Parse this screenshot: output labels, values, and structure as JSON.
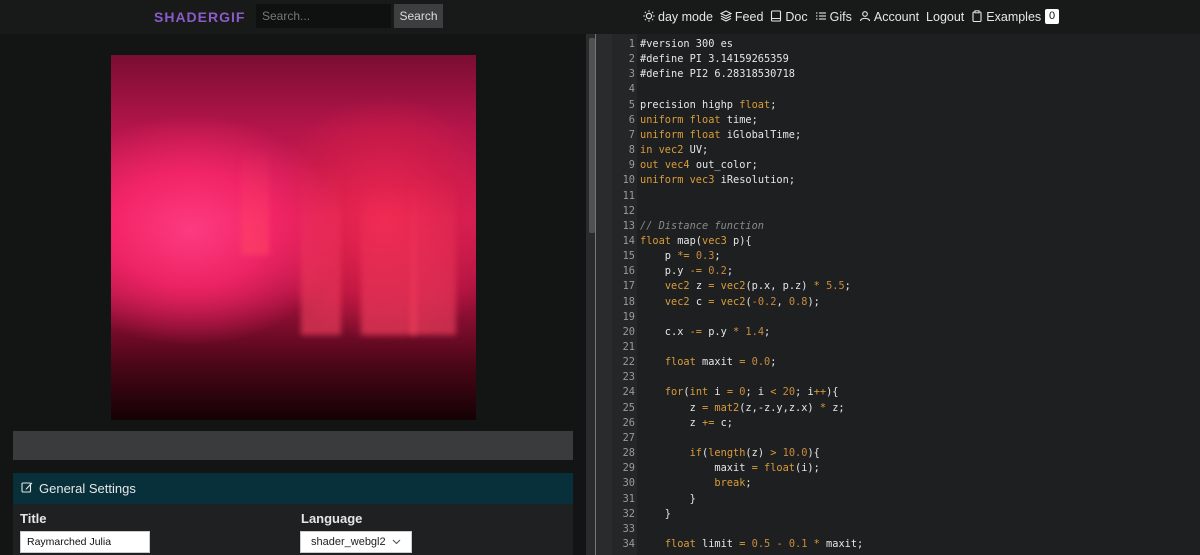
{
  "header": {
    "logo": "SHADERGIF",
    "search_placeholder": "Search...",
    "search_button": "Search",
    "nav": [
      {
        "label": "day mode",
        "icon": "sun-icon"
      },
      {
        "label": "Feed",
        "icon": "layers-icon"
      },
      {
        "label": "Doc",
        "icon": "book-icon"
      },
      {
        "label": "Gifs",
        "icon": "list-icon"
      },
      {
        "label": "Account",
        "icon": "user-icon"
      },
      {
        "label": "Logout",
        "icon": ""
      },
      {
        "label": "Examples",
        "icon": "clipboard-icon"
      }
    ],
    "badge": "0"
  },
  "settings": {
    "heading": "General Settings",
    "title_label": "Title",
    "title_value": "Raymarched Julia",
    "language_label": "Language",
    "language_value": "shader_webgl2"
  },
  "editor": {
    "lines": [
      [
        [
          "#version 300 es",
          ""
        ]
      ],
      [
        [
          "#define PI 3.14159265359",
          ""
        ]
      ],
      [
        [
          "#define PI2 6.28318530718",
          ""
        ]
      ],
      [],
      [
        [
          "precision highp ",
          ""
        ],
        [
          "float",
          "kw"
        ],
        [
          ";",
          ""
        ]
      ],
      [
        [
          "uniform",
          "kw"
        ],
        [
          " ",
          ""
        ],
        [
          "float",
          "kw"
        ],
        [
          " time;",
          ""
        ]
      ],
      [
        [
          "uniform",
          "kw"
        ],
        [
          " ",
          ""
        ],
        [
          "float",
          "kw"
        ],
        [
          " iGlobalTime;",
          ""
        ]
      ],
      [
        [
          "in",
          "kw"
        ],
        [
          " ",
          ""
        ],
        [
          "vec2",
          "kw"
        ],
        [
          " UV;",
          ""
        ]
      ],
      [
        [
          "out",
          "kw"
        ],
        [
          " ",
          ""
        ],
        [
          "vec4",
          "kw"
        ],
        [
          " out_color;",
          ""
        ]
      ],
      [
        [
          "uniform",
          "kw"
        ],
        [
          " ",
          ""
        ],
        [
          "vec3",
          "kw"
        ],
        [
          " iResolution;",
          ""
        ]
      ],
      [],
      [],
      [
        [
          "// Distance function",
          "cm"
        ]
      ],
      [
        [
          "float",
          "kw"
        ],
        [
          " map(",
          ""
        ],
        [
          "vec3",
          "kw"
        ],
        [
          " p){",
          ""
        ]
      ],
      [
        [
          "    p ",
          ""
        ],
        [
          "*=",
          "kw"
        ],
        [
          " ",
          ""
        ],
        [
          "0.3",
          "num"
        ],
        [
          ";",
          ""
        ]
      ],
      [
        [
          "    p.y ",
          ""
        ],
        [
          "-=",
          "kw"
        ],
        [
          " ",
          ""
        ],
        [
          "0.2",
          "num"
        ],
        [
          ";",
          ""
        ]
      ],
      [
        [
          "    ",
          ""
        ],
        [
          "vec2",
          "kw"
        ],
        [
          " z ",
          ""
        ],
        [
          "=",
          "kw"
        ],
        [
          " ",
          ""
        ],
        [
          "vec2",
          "kw"
        ],
        [
          "(p.x, p.z) ",
          ""
        ],
        [
          "*",
          "kw"
        ],
        [
          " ",
          ""
        ],
        [
          "5.5",
          "num"
        ],
        [
          ";",
          ""
        ]
      ],
      [
        [
          "    ",
          ""
        ],
        [
          "vec2",
          "kw"
        ],
        [
          " c ",
          ""
        ],
        [
          "=",
          "kw"
        ],
        [
          " ",
          ""
        ],
        [
          "vec2",
          "kw"
        ],
        [
          "(",
          ""
        ],
        [
          "-0.2",
          "num"
        ],
        [
          ", ",
          ""
        ],
        [
          "0.8",
          "num"
        ],
        [
          ");",
          ""
        ]
      ],
      [],
      [
        [
          "    c.x ",
          ""
        ],
        [
          "-=",
          "kw"
        ],
        [
          " p.y ",
          ""
        ],
        [
          "*",
          "kw"
        ],
        [
          " ",
          ""
        ],
        [
          "1.4",
          "num"
        ],
        [
          ";",
          ""
        ]
      ],
      [],
      [
        [
          "    ",
          ""
        ],
        [
          "float",
          "kw"
        ],
        [
          " maxit ",
          ""
        ],
        [
          "=",
          "kw"
        ],
        [
          " ",
          ""
        ],
        [
          "0.0",
          "num"
        ],
        [
          ";",
          ""
        ]
      ],
      [],
      [
        [
          "    ",
          ""
        ],
        [
          "for",
          "kw"
        ],
        [
          "(",
          ""
        ],
        [
          "int",
          "kw"
        ],
        [
          " i ",
          ""
        ],
        [
          "=",
          "kw"
        ],
        [
          " ",
          ""
        ],
        [
          "0",
          "num"
        ],
        [
          "; i ",
          ""
        ],
        [
          "<",
          "kw"
        ],
        [
          " ",
          ""
        ],
        [
          "20",
          "num"
        ],
        [
          "; i",
          ""
        ],
        [
          "++",
          "kw"
        ],
        [
          "){",
          ""
        ]
      ],
      [
        [
          "        z ",
          ""
        ],
        [
          "=",
          "kw"
        ],
        [
          " ",
          ""
        ],
        [
          "mat2",
          "kw"
        ],
        [
          "(z,-z.y,z.x) ",
          ""
        ],
        [
          "*",
          "kw"
        ],
        [
          " z;",
          ""
        ]
      ],
      [
        [
          "        z ",
          ""
        ],
        [
          "+=",
          "kw"
        ],
        [
          " c;",
          ""
        ]
      ],
      [],
      [
        [
          "        ",
          ""
        ],
        [
          "if",
          "kw"
        ],
        [
          "(",
          ""
        ],
        [
          "length",
          "kw"
        ],
        [
          "(z) ",
          ""
        ],
        [
          ">",
          "kw"
        ],
        [
          " ",
          ""
        ],
        [
          "10.0",
          "num"
        ],
        [
          "){",
          ""
        ]
      ],
      [
        [
          "            maxit ",
          ""
        ],
        [
          "=",
          "kw"
        ],
        [
          " ",
          ""
        ],
        [
          "float",
          "kw"
        ],
        [
          "(i);",
          ""
        ]
      ],
      [
        [
          "            ",
          ""
        ],
        [
          "break",
          "kw"
        ],
        [
          ";",
          ""
        ]
      ],
      [
        [
          "        }",
          ""
        ]
      ],
      [
        [
          "    }",
          ""
        ]
      ],
      [],
      [
        [
          "    ",
          ""
        ],
        [
          "float",
          "kw"
        ],
        [
          " limit ",
          ""
        ],
        [
          "=",
          "kw"
        ],
        [
          " ",
          ""
        ],
        [
          "0.5",
          "num"
        ],
        [
          " ",
          ""
        ],
        [
          "-",
          "kw"
        ],
        [
          " ",
          ""
        ],
        [
          "0.1",
          "num"
        ],
        [
          " ",
          ""
        ],
        [
          "*",
          "kw"
        ],
        [
          " maxit;",
          ""
        ]
      ]
    ]
  }
}
